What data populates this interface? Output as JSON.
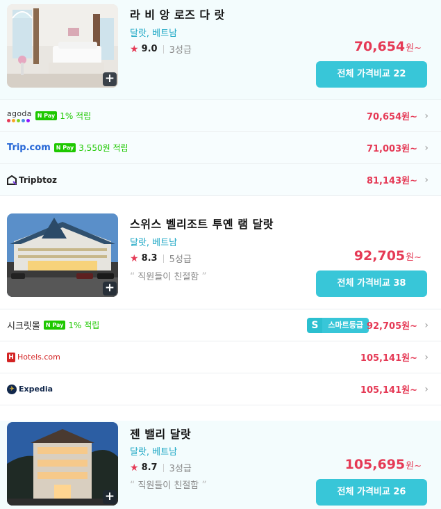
{
  "hotels": [
    {
      "name": "라 비 앙 로즈 다 랏",
      "location": "달랏, 베트남",
      "rating": "9.0",
      "grade": "3성급",
      "review": "",
      "price": "70,654",
      "price_unit": "원~",
      "compare_label": "전체 가격비교 22",
      "offers": [
        {
          "provider": "agoda",
          "npay": "1% 적립",
          "price": "70,654원~"
        },
        {
          "provider": "Trip.com",
          "npay": "3,550원 적립",
          "price": "71,003원~"
        },
        {
          "provider": "Tripbtoz",
          "npay": "",
          "price": "81,143원~"
        }
      ]
    },
    {
      "name": "스위스 벨리조트 투옌 램 달랏",
      "location": "달랏, 베트남",
      "rating": "8.3",
      "grade": "5성급",
      "review": "직원들이 친절함",
      "price": "92,705",
      "price_unit": "원~",
      "compare_label": "전체 가격비교 38",
      "offers": [
        {
          "provider": "시크릿몰",
          "npay": "1% 적립",
          "smart_s": "S",
          "smart_label": "스마트등급",
          "price": "92,705원~"
        },
        {
          "provider": "Hotels.com",
          "npay": "",
          "price": "105,141원~"
        },
        {
          "provider": "Expedia",
          "npay": "",
          "price": "105,141원~"
        }
      ]
    },
    {
      "name": "젠 밸리 달랏",
      "location": "달랏, 베트남",
      "rating": "8.7",
      "grade": "3성급",
      "review": "직원들이 친절함",
      "price": "105,695",
      "price_unit": "원~",
      "compare_label": "전체 가격비교 26"
    }
  ],
  "npay_badge": "N Pay",
  "colors": {
    "accent": "#38c6d8",
    "price": "#e53955",
    "location": "#1aa6c4",
    "npay": "#1ec800"
  }
}
